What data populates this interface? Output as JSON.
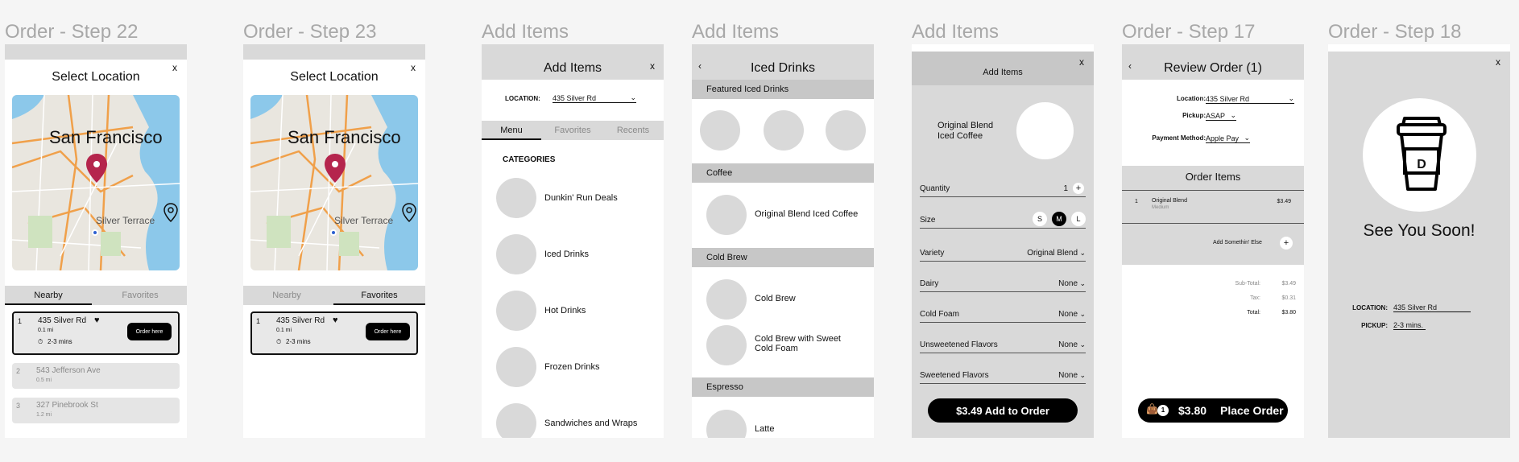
{
  "frames": [
    {
      "title": "Order - Step 22",
      "header": "Select Location",
      "close": "x",
      "map": {
        "city": "San Francisco",
        "area": "Silver Terrace"
      },
      "tabs": [
        "Nearby",
        "Favorites"
      ],
      "active_tab": "Nearby",
      "locations": [
        {
          "num": "1",
          "name": "435 Silver Rd",
          "distance": "0.1 mi",
          "time": "2-3 mins",
          "button": "Order here"
        },
        {
          "num": "2",
          "name": "543 Jefferson Ave",
          "distance": "0.5 mi"
        },
        {
          "num": "3",
          "name": "327 Pinebrook St",
          "distance": "1.2 mi"
        }
      ]
    },
    {
      "title": "Order - Step 23",
      "header": "Select Location",
      "close": "x",
      "map": {
        "city": "San Francisco",
        "area": "Silver Terrace"
      },
      "tabs": [
        "Nearby",
        "Favorites"
      ],
      "active_tab": "Favorites",
      "locations": [
        {
          "num": "1",
          "name": "435 Silver Rd",
          "distance": "0.1 mi",
          "time": "2-3 mins",
          "button": "Order here"
        }
      ]
    },
    {
      "title": "Add Items",
      "header": "Add Items",
      "close": "x",
      "location_label": "LOCATION:",
      "location_value": "435 Silver Rd",
      "tabs": [
        "Menu",
        "Favorites",
        "Recents"
      ],
      "active_tab": "Menu",
      "categories_label": "CATEGORIES",
      "categories": [
        "Dunkin' Run Deals",
        "Iced Drinks",
        "Hot Drinks",
        "Frozen Drinks",
        "Sandwiches and Wraps"
      ]
    },
    {
      "title": "Add Items",
      "back": "‹",
      "header": "Iced Drinks",
      "sections": {
        "featured": "Featured Iced Drinks",
        "coffee": "Coffee",
        "coffee_items": [
          "Original Blend Iced Coffee"
        ],
        "cold_brew": "Cold Brew",
        "cold_brew_items": [
          "Cold Brew",
          "Cold Brew with Sweet Cold Foam"
        ],
        "espresso": "Espresso",
        "espresso_items": [
          "Latte"
        ]
      }
    },
    {
      "title": "Add Items",
      "header": "Add Items",
      "close": "x",
      "product_name": "Original Blend Iced Coffee",
      "options": {
        "quantity_label": "Quantity",
        "quantity_value": "1",
        "plus": "+",
        "size_label": "Size",
        "sizes": [
          "S",
          "M",
          "L"
        ],
        "size_selected": "M",
        "variety_label": "Variety",
        "variety_value": "Original Blend",
        "dairy_label": "Dairy",
        "dairy_value": "None",
        "cold_foam_label": "Cold Foam",
        "cold_foam_value": "None",
        "unsweetened_label": "Unsweetened Flavors",
        "unsweetened_value": "None",
        "sweetened_label": "Sweetened Flavors",
        "sweetened_value": "None"
      },
      "cta": "$3.49 Add to Order"
    },
    {
      "title": "Order - Step 17",
      "back": "‹",
      "header": "Review Order (1)",
      "fields": {
        "location_label": "Location:",
        "location_value": "435 Silver Rd",
        "pickup_label": "Pickup:",
        "pickup_value": "ASAP",
        "payment_label": "Payment Method:",
        "payment_value": "Apple Pay"
      },
      "order_items_label": "Order Items",
      "item": {
        "num": "1",
        "name": "Original Blend",
        "size": "Medium",
        "price": "$3.49"
      },
      "add_else": "Add Somethin' Else",
      "plus": "+",
      "totals": {
        "subtotal_label": "Sub-Total:",
        "subtotal": "$3.49",
        "tax_label": "Tax:",
        "tax": "$0.31",
        "total_label": "Total:",
        "total": "$3.80"
      },
      "bag_count": "1",
      "cta_price": "$3.80",
      "cta_label": "Place Order"
    },
    {
      "title": "Order - Step 18",
      "close": "x",
      "cup_letter": "D",
      "message": "See You Soon!",
      "location_label": "LOCATION:",
      "location_value": "435 Silver Rd",
      "pickup_label": "PICKUP:",
      "pickup_value": "2-3 mins."
    }
  ]
}
